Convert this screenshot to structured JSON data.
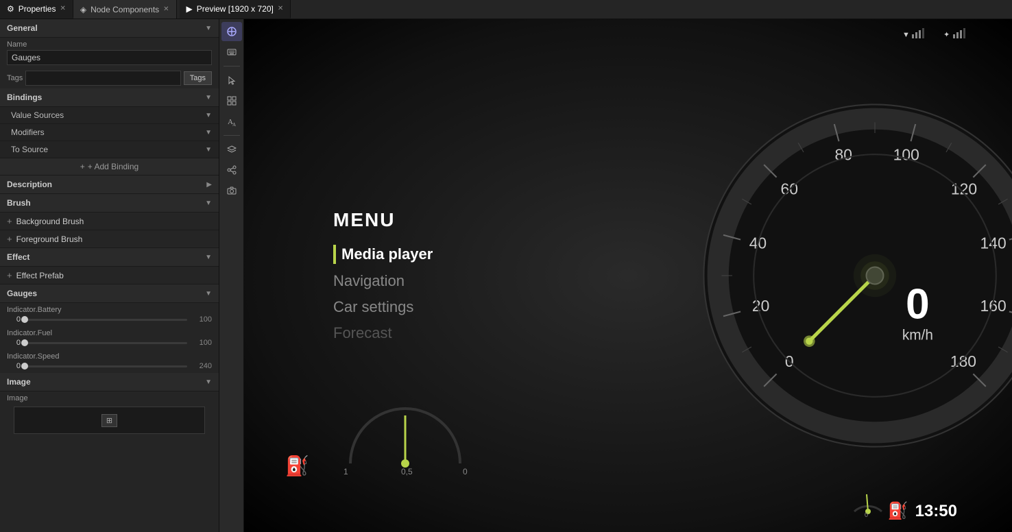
{
  "tabs": [
    {
      "id": "properties",
      "icon": "⚙",
      "label": "Properties",
      "active": true
    },
    {
      "id": "node-components",
      "icon": "◈",
      "label": "Node Components",
      "active": false
    },
    {
      "id": "preview",
      "icon": "▶",
      "label": "Preview [1920 x 720]",
      "active": true
    }
  ],
  "left_panel": {
    "general": {
      "title": "General",
      "name_label": "Name",
      "name_value": "Gauges",
      "tags_label": "Tags",
      "tags_btn": "Tags"
    },
    "bindings": {
      "title": "Bindings",
      "value_sources": "Value Sources",
      "modifiers": "Modifiers",
      "to_source": "To Source",
      "add_binding": "+ Add Binding"
    },
    "description": {
      "title": "Description"
    },
    "brush": {
      "title": "Brush",
      "background": "Background Brush",
      "foreground": "Foreground Brush"
    },
    "effect": {
      "title": "Effect",
      "effect_prefab": "Effect Prefab"
    },
    "gauges": {
      "title": "Gauges",
      "indicators": [
        {
          "name": "Indicator.Battery",
          "min": 0,
          "current": 0,
          "max": 100,
          "percent": 0
        },
        {
          "name": "Indicator.Fuel",
          "min": 0,
          "current": 0,
          "max": 100,
          "percent": 0
        },
        {
          "name": "Indicator.Speed",
          "min": 0,
          "current": 0,
          "max": 240,
          "percent": 0
        }
      ]
    },
    "image": {
      "title": "Image",
      "image_label": "Image"
    }
  },
  "preview": {
    "title": "Preview [1920 x 720]",
    "menu": {
      "title": "MENU",
      "items": [
        {
          "label": "Media player",
          "selected": true,
          "faded": false
        },
        {
          "label": "Navigation",
          "selected": false,
          "faded": false
        },
        {
          "label": "Car settings",
          "selected": false,
          "faded": false
        },
        {
          "label": "Forecast",
          "selected": false,
          "faded": true
        }
      ]
    },
    "speedometer": {
      "speed": "0",
      "unit": "km/h",
      "ticks": [
        0,
        20,
        40,
        60,
        80,
        100,
        120,
        140,
        160,
        180
      ]
    },
    "status": {
      "signal1": "▼.▌▌",
      "bluetooth": "₿.▌▌",
      "time": "13:50"
    },
    "fuel": {
      "icon": "⛽",
      "value": "1",
      "mid_value": "0,5",
      "low_value": "0"
    }
  },
  "toolbar": {
    "tools": [
      {
        "id": "pointer-cursor",
        "icon": "↖",
        "active": true
      },
      {
        "id": "keyboard",
        "icon": "⌨",
        "active": false
      },
      {
        "id": "cursor-arrow",
        "icon": "↖",
        "active": false
      },
      {
        "id": "grid",
        "icon": "⊞",
        "active": false
      },
      {
        "id": "text-size",
        "icon": "A",
        "active": false
      },
      {
        "id": "layers",
        "icon": "◧",
        "active": false
      },
      {
        "id": "share",
        "icon": "⎇",
        "active": false
      },
      {
        "id": "camera",
        "icon": "⛁",
        "active": false
      }
    ]
  }
}
